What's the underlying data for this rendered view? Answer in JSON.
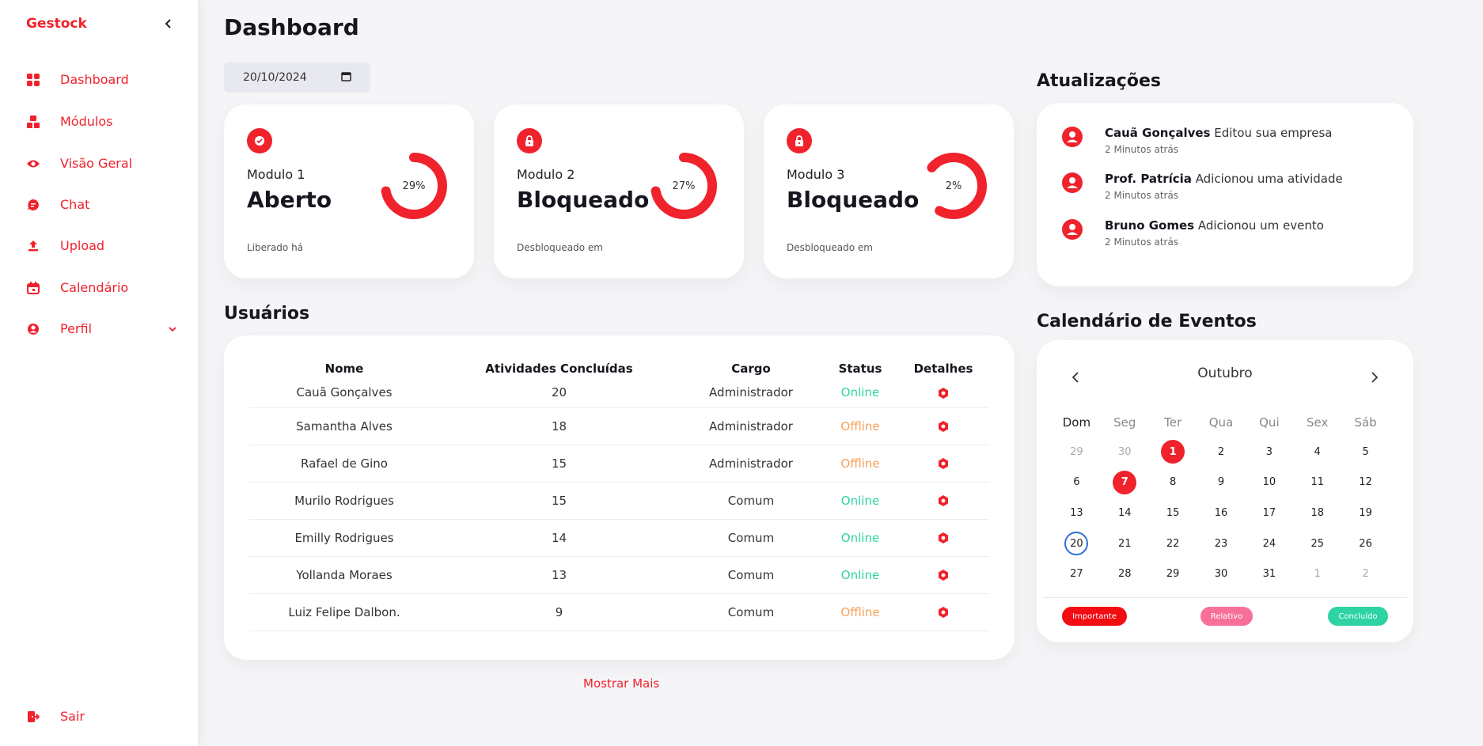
{
  "sidebar": {
    "brand": "Gestock",
    "collapse_icon": "chevron-left-icon",
    "items": [
      {
        "label": "Dashboard",
        "icon": "grid-icon"
      },
      {
        "label": "Módulos",
        "icon": "blocks-icon"
      },
      {
        "label": "Visão Geral",
        "icon": "eye-icon"
      },
      {
        "label": "Chat",
        "icon": "chat-icon"
      },
      {
        "label": "Upload",
        "icon": "upload-icon"
      },
      {
        "label": "Calendário",
        "icon": "calendar-icon"
      },
      {
        "label": "Perfil",
        "icon": "user-icon"
      }
    ],
    "logout": "Sair"
  },
  "header": {
    "title": "Dashboard",
    "date_value": "20/10/2024"
  },
  "modules": [
    {
      "name": "Modulo 1",
      "state": "Aberto",
      "footer": "Liberado há",
      "percent_label": "29%",
      "progress": 0.29,
      "icon": "check-icon"
    },
    {
      "name": "Modulo 2",
      "state": "Bloqueado",
      "footer": "Desbloqueado em",
      "percent_label": "27%",
      "progress": 0.27,
      "icon": "lock-icon"
    },
    {
      "name": "Modulo 3",
      "state": "Bloqueado",
      "footer": "Desbloqueado em",
      "percent_label": "2%",
      "progress": 0.02,
      "icon": "lock-icon"
    }
  ],
  "users": {
    "title": "Usuários",
    "columns": [
      "Nome",
      "Atividades Concluídas",
      "Cargo",
      "Status",
      "Detalhes"
    ],
    "rows": [
      {
        "name": "Cauã Gonçalves",
        "activities": "20",
        "role": "Administrador",
        "status": "Online"
      },
      {
        "name": "Samantha Alves",
        "activities": "18",
        "role": "Administrador",
        "status": "Offline"
      },
      {
        "name": "Rafael de Gino",
        "activities": "15",
        "role": "Administrador",
        "status": "Offline"
      },
      {
        "name": "Murilo Rodrigues",
        "activities": "15",
        "role": "Comum",
        "status": "Online"
      },
      {
        "name": "Emilly Rodrigues",
        "activities": "14",
        "role": "Comum",
        "status": "Online"
      },
      {
        "name": "Yollanda Moraes",
        "activities": "13",
        "role": "Comum",
        "status": "Online"
      },
      {
        "name": "Luiz Felipe Dalbon.",
        "activities": "9",
        "role": "Comum",
        "status": "Offline"
      }
    ],
    "show_more": "Mostrar Mais"
  },
  "updates": {
    "title": "Atualizações",
    "items": [
      {
        "who": "Cauã Gonçalves",
        "action": "Editou sua empresa",
        "time": "2 Minutos atrás"
      },
      {
        "who": "Prof. Patrícia",
        "action": "Adicionou uma atividade",
        "time": "2 Minutos atrás"
      },
      {
        "who": "Bruno Gomes",
        "action": "Adicionou um evento",
        "time": "2 Minutos atrás"
      }
    ]
  },
  "calendar": {
    "title": "Calendário de Eventos",
    "month": "Outubro",
    "weekdays": [
      "Dom",
      "Seg",
      "Ter",
      "Qua",
      "Qui",
      "Sex",
      "Sáb"
    ],
    "weeks": [
      [
        "29",
        "30",
        "1",
        "2",
        "3",
        "4",
        "5"
      ],
      [
        "6",
        "7",
        "8",
        "9",
        "10",
        "11",
        "12"
      ],
      [
        "13",
        "14",
        "15",
        "16",
        "17",
        "18",
        "19"
      ],
      [
        "20",
        "21",
        "22",
        "23",
        "24",
        "25",
        "26"
      ],
      [
        "27",
        "28",
        "29",
        "30",
        "31",
        "1",
        "2"
      ]
    ],
    "legend": [
      "Importante",
      "Relativo",
      "Concluído"
    ]
  },
  "colors": {
    "accent": "#f0222c",
    "online": "#2dd4a2",
    "offline": "#f5a15a",
    "importante": "#f20d12",
    "relativo": "#f7709a",
    "concluido": "#2ed3a4",
    "today_ring": "#2e6fd8"
  }
}
